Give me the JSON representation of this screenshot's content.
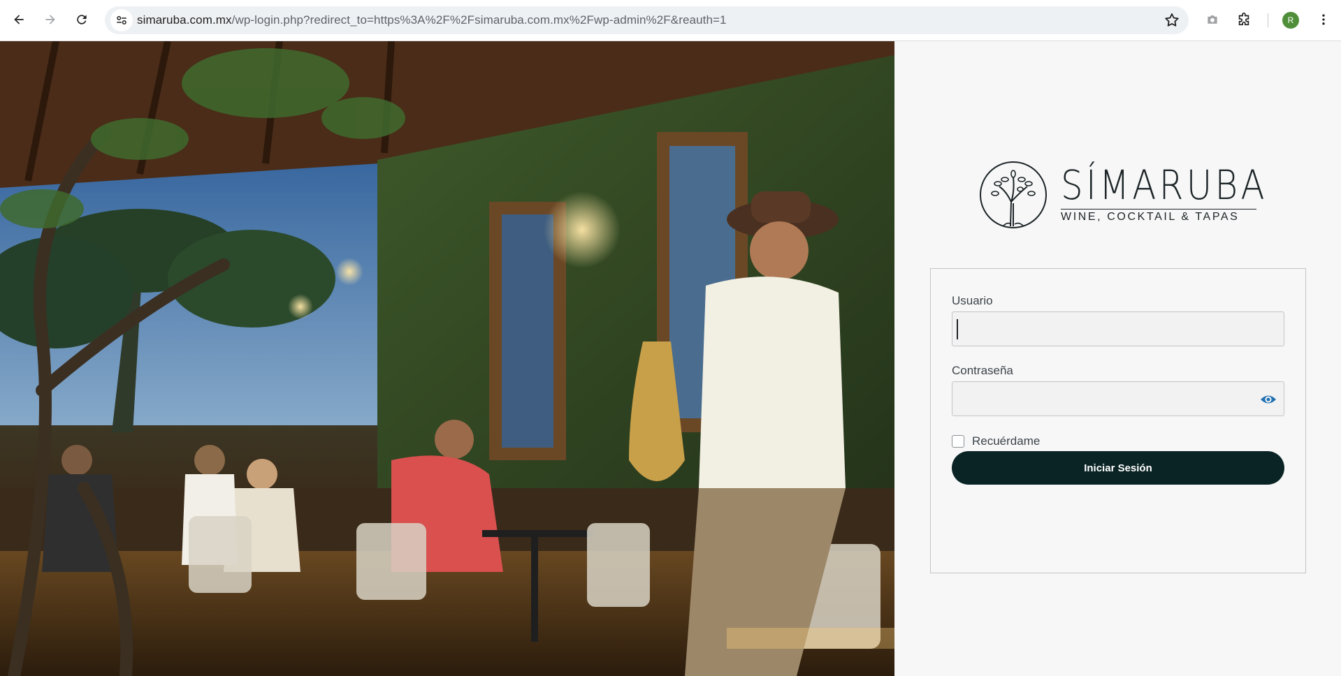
{
  "browser": {
    "url_host": "simaruba.com.mx",
    "url_path": "/wp-login.php?redirect_to=https%3A%2F%2Fsimaruba.com.mx%2Fwp-admin%2F&reauth=1",
    "avatar_letter": "R"
  },
  "brand": {
    "name": "SÍMARUBA",
    "tagline": "WINE, COCKTAIL & TAPAS",
    "color": "#1c2427"
  },
  "login": {
    "username_label": "Usuario",
    "username_value": "",
    "password_label": "Contraseña",
    "password_value": "",
    "remember_label": "Recuérdame",
    "remember_checked": false,
    "submit_label": "Iniciar Sesión",
    "button_color": "#0a2325",
    "accent_color": "#2271b1"
  },
  "icons": [
    "back-arrow-icon",
    "forward-arrow-icon",
    "reload-icon",
    "site-settings-icon",
    "bookmark-star-icon",
    "camera-icon",
    "extensions-icon",
    "kebab-menu-icon",
    "show-password-eye-icon",
    "logo-tree-emblem-icon"
  ]
}
